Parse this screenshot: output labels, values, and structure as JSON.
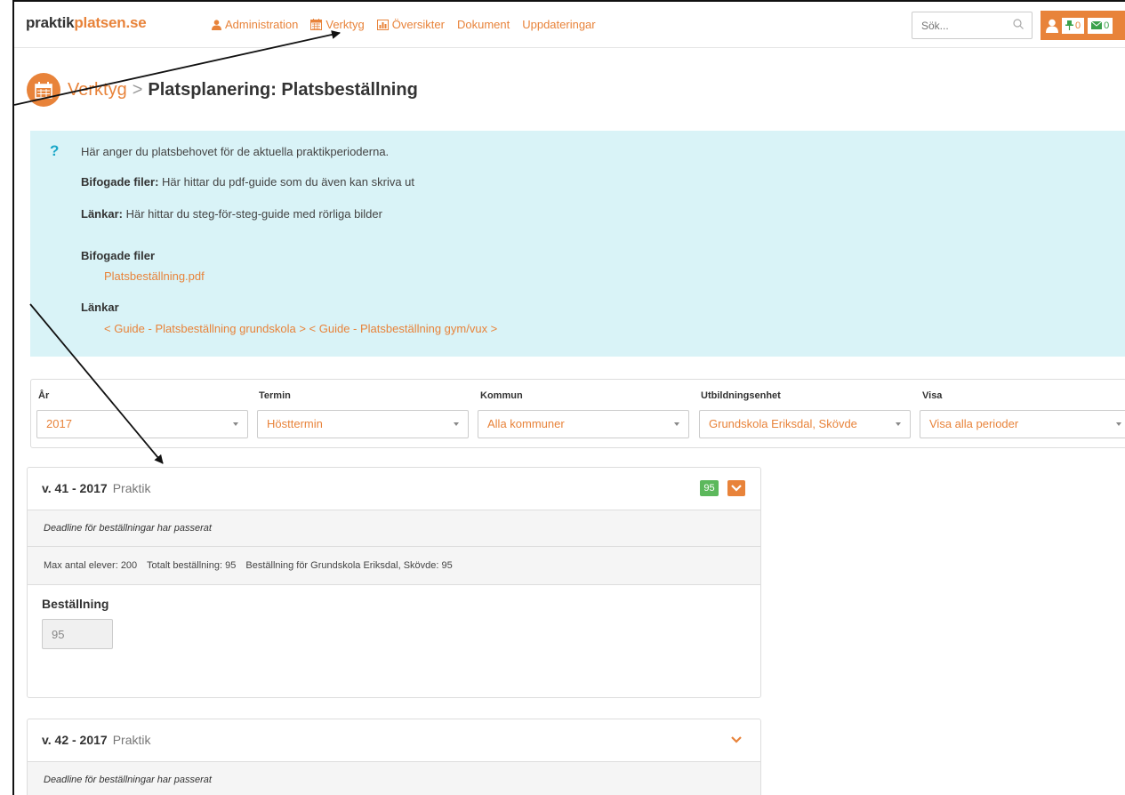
{
  "logo": {
    "part1": "praktik",
    "part2": "platsen.se"
  },
  "nav": [
    {
      "label": "Administration",
      "icon": "user-icon"
    },
    {
      "label": "Verktyg",
      "icon": "calendar-icon"
    },
    {
      "label": "Översikter",
      "icon": "bar-chart-icon"
    },
    {
      "label": "Dokument",
      "icon": ""
    },
    {
      "label": "Uppdateringar",
      "icon": ""
    }
  ],
  "search": {
    "placeholder": "Sök..."
  },
  "user_menu": {
    "pin_count": "0",
    "mail_count": "0"
  },
  "title": {
    "crumb": "Verktyg",
    "separator": ">",
    "page": "Platsplanering: Platsbeställning"
  },
  "info": {
    "intro": "Här anger du platsbehovet för de aktuella praktikperioderna.",
    "files_label": "Bifogade filer:",
    "files_text": "Här hittar du pdf-guide som du även kan skriva ut",
    "links_label": "Länkar:",
    "links_text": "Här hittar du steg-för-steg-guide med rörliga bilder",
    "attached_heading": "Bifogade filer",
    "attached_file": "Platsbeställning.pdf",
    "links_heading": "Länkar",
    "link1": "< Guide - Platsbeställning grundskola >",
    "link2": "< Guide - Platsbeställning gym/vux >"
  },
  "filters": {
    "year": {
      "label": "År",
      "value": "2017"
    },
    "term": {
      "label": "Termin",
      "value": "Hösttermin"
    },
    "municipality": {
      "label": "Kommun",
      "value": "Alla kommuner"
    },
    "unit": {
      "label": "Utbildningsenhet",
      "value": "Grundskola Eriksdal, Skövde"
    },
    "show": {
      "label": "Visa",
      "value": "Visa alla perioder"
    }
  },
  "periods": [
    {
      "week": "v. 41 - 2017",
      "type": "Praktik",
      "badge": "95",
      "deadline": "Deadline för beställningar har passerat",
      "max_students": "Max antal elever: 200",
      "total_ordered": "Totalt beställning: 95",
      "unit_order": "Beställning för Grundskola Eriksdal, Skövde: 95",
      "order_label": "Beställning",
      "order_value": "95"
    },
    {
      "week": "v. 42 - 2017",
      "type": "Praktik",
      "deadline": "Deadline för beställningar har passerat"
    }
  ],
  "colors": {
    "accent": "#e8833a",
    "info_bg": "#d9f3f7",
    "badge_green": "#5cb85c",
    "help_blue": "#1ba7c8"
  }
}
